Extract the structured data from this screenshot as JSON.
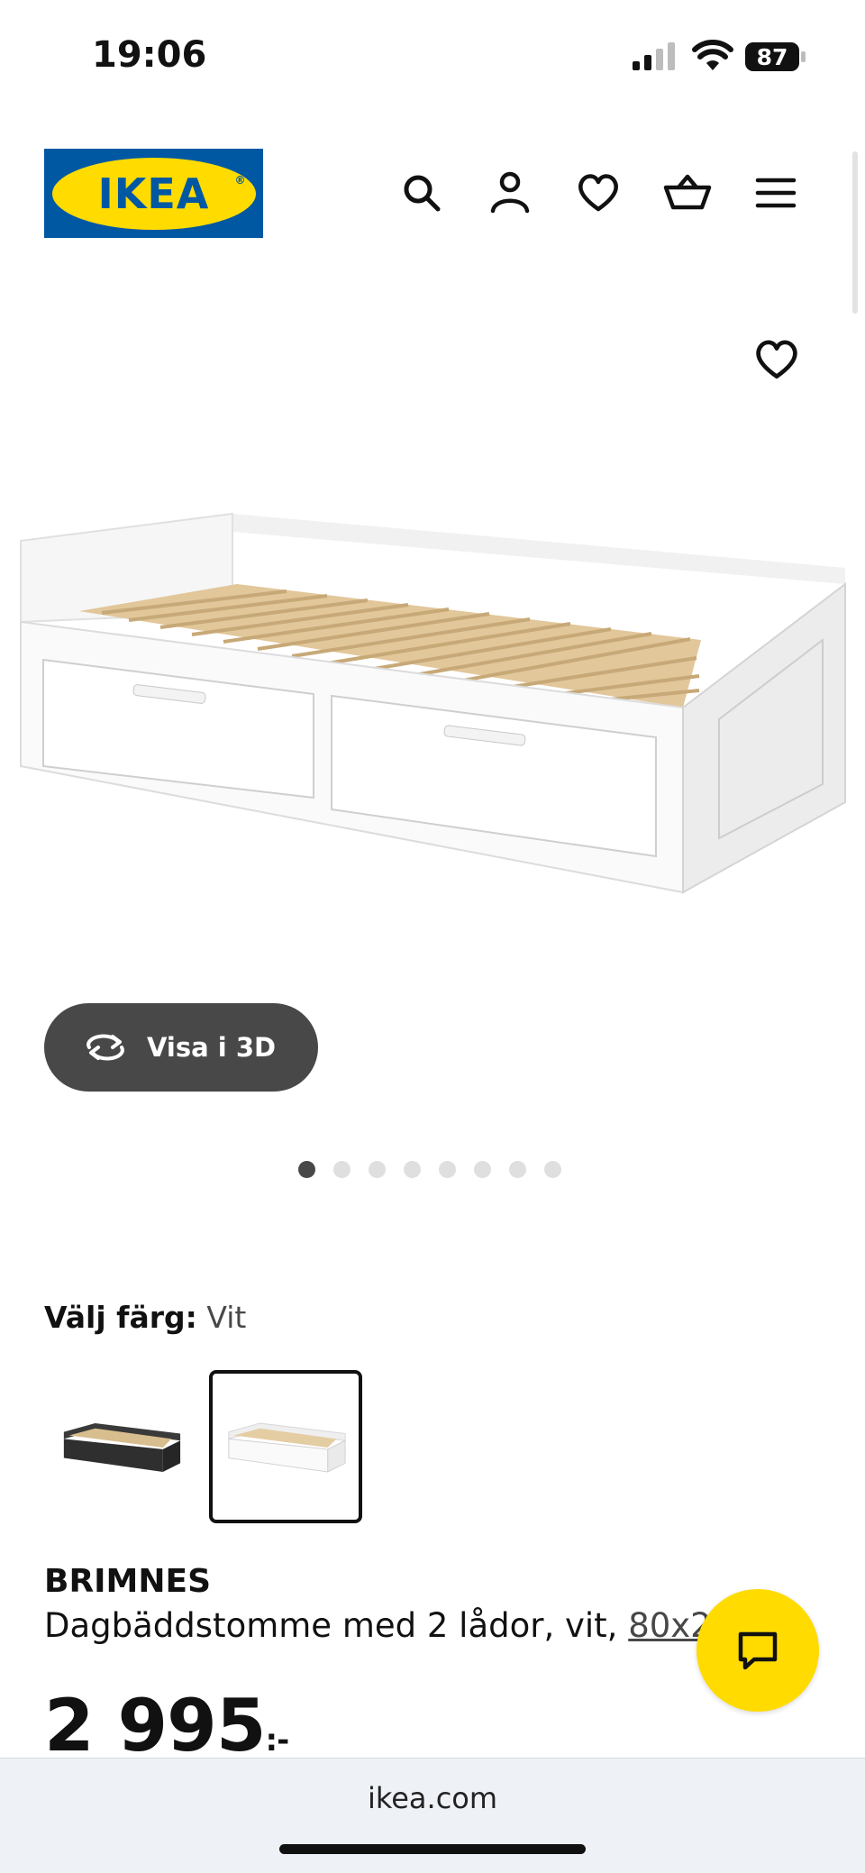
{
  "status_bar": {
    "time": "19:06",
    "battery": "87"
  },
  "header": {
    "logo_text": "IKEA",
    "logo_colors": {
      "blue": "#0058a3",
      "yellow": "#ffdb00"
    },
    "icons": [
      "search-icon",
      "account-icon",
      "heart-icon",
      "cart-icon",
      "menu-icon"
    ]
  },
  "product_media": {
    "view_3d_label": "Visa i 3D",
    "image_count": 8,
    "active_image_index": 0
  },
  "color_selector": {
    "label": "Välj färg:",
    "selected_value": "Vit",
    "options": [
      "black-brown",
      "white"
    ],
    "selected_index": 1
  },
  "product": {
    "name": "BRIMNES",
    "description": "Dagbäddstomme med 2 lådor, vit,",
    "size_link": "80x20",
    "price": "2 995",
    "price_suffix": ":-"
  },
  "browser": {
    "url": "ikea.com"
  }
}
